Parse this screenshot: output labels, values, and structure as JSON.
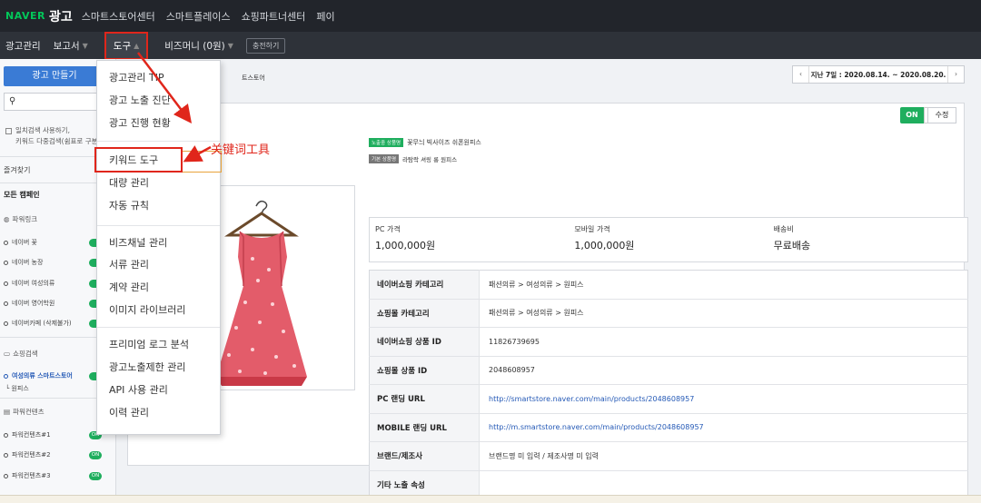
{
  "topbar": {
    "logo_naver": "NAVER",
    "logo_ad": "광고",
    "nav": [
      "스마트스토어센터",
      "스마트플레이스",
      "쇼핑파트너센터",
      "페이"
    ]
  },
  "subbar": {
    "items": [
      "광고관리",
      "보고서",
      "도구",
      "비즈머니 (0원)"
    ],
    "charge": "충전하기"
  },
  "sidebar": {
    "create_button": "광고 만들기",
    "check_line1": "일치검색 사용하기,",
    "check_line2": "키워드 다중검색(쉼표로 구분",
    "favorites": "즐겨찾기",
    "all_campaigns": "모든 캠페인",
    "group_powerlink": "파워링크",
    "powerlink_items": [
      "네이버 꽃",
      "네이버 농장",
      "네이버 여성의류",
      "네이버 영어학원",
      "네이버카페 (삭제불가)"
    ],
    "group_shopping": "쇼핑검색",
    "shopping_item": "여성의류 스마트스토어",
    "shopping_child": "원피스",
    "group_content": "파워컨텐츠",
    "content_items": [
      "파워컨텐츠#1",
      "파워컨텐츠#2",
      "파워컨텐츠#3"
    ],
    "switch_on": "ON"
  },
  "dropdown": {
    "items_a": [
      "광고관리 TIP",
      "광고 노출 진단",
      "광고 진행 현황"
    ],
    "items_b": [
      "키워드 도구",
      "대량 관리",
      "자동 규칙"
    ],
    "items_c": [
      "비즈채널 관리",
      "서류 관리",
      "계약 관리",
      "이미지 라이브러리"
    ],
    "items_d": [
      "프리미엄 로그 분석",
      "광고노출제한 관리",
      "API 사용 관리",
      "이력 관리"
    ]
  },
  "annotation": "关键词工具",
  "main": {
    "breadcrumb": "트스토어",
    "period": "지난 7일 : 2020.08.14. ~ 2020.08.20.",
    "toggle": "ON",
    "edit": "수정",
    "badge1": "노출중 상품명",
    "product_name": "꽃무늬 빅사이즈 쉬폰원피스",
    "badge2": "기본 상품명",
    "product_sub": "라탐락 셔링 롱 원피스",
    "price": {
      "pc_label": "PC 가격",
      "pc_value": "1,000,000원",
      "mobile_label": "모바일 가격",
      "mobile_value": "1,000,000원",
      "ship_label": "배송비",
      "ship_value": "무료배송"
    },
    "table": [
      {
        "k": "네이버쇼핑 카테고리",
        "v": "패션의류 > 여성의류 > 원피스"
      },
      {
        "k": "쇼핑몰 카테고리",
        "v": "패션의류 > 여성의류 > 원피스"
      },
      {
        "k": "네이버쇼핑 상품 ID",
        "v": "11826739695"
      },
      {
        "k": "쇼핑몰 상품 ID",
        "v": "2048608957"
      },
      {
        "k": "PC 랜딩 URL",
        "v": "http://smartstore.naver.com/main/products/2048608957"
      },
      {
        "k": "MOBILE 랜딩 URL",
        "v": "http://m.smartstore.naver.com/main/products/2048608957"
      },
      {
        "k": "브랜드/제조사",
        "v": "브랜드명 미 입력 / 제조사명 미 입력"
      },
      {
        "k": "기타 노출 속성",
        "v": ""
      }
    ]
  },
  "colors": {
    "accent_red": "#e0261b",
    "naver_green": "#03c75a",
    "primary_blue": "#3a7bd5"
  }
}
